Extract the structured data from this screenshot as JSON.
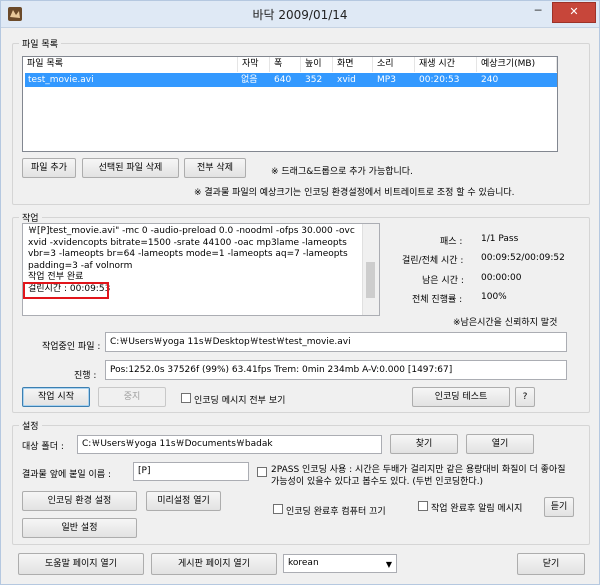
{
  "window": {
    "title": "바닥 2009/01/14",
    "minimize": "─",
    "close": "✕"
  },
  "file_list": {
    "group_label": "파일 목록",
    "columns": [
      "파일 목록",
      "자막",
      "폭",
      "높이",
      "화면",
      "소리",
      "재생 시간",
      "예상크기(MB)"
    ],
    "rows": [
      {
        "name": "test_movie.avi",
        "subtitle": "없음",
        "width": "640",
        "height": "352",
        "video": "xvid",
        "audio": "MP3",
        "duration": "00:20:53",
        "size": "240"
      }
    ],
    "add_button": "파일 추가",
    "delete_selected_button": "선택된 파일 삭제",
    "delete_all_button": "전부 삭제",
    "drag_hint": "※ 드래그&드롭으로 추가 가능합니다.",
    "size_hint": "※ 결과물 파일의 예상크기는 인코딩 환경설정에서 비트레이트로 조정 할 수 있습니다."
  },
  "job": {
    "group_label": "작업",
    "log_text": "￦[P]test_movie.avi\" -mc 0 -audio-preload 0.0 -noodml -ofps 30.000 -ovc xvid -xvidencopts bitrate=1500 -srate 44100 -oac mp3lame -lameopts vbr=3 -lameopts br=64 -lameopts mode=1 -lameopts aq=7 -lameopts padding=3 -af volnorm\n작업 전부 완료\n걸린시간 : 00:09:53",
    "pass_label": "패스 :",
    "pass_value": "1/1 Pass",
    "elapsed_label": "걸린/전체 시간 :",
    "elapsed_value": "00:09:52/00:09:52",
    "remaining_label": "남은 시간 :",
    "remaining_value": "00:00:00",
    "progress_label": "전체 진행률 :",
    "progress_value": "100%",
    "remaining_note": "※남은시간을 신뢰하지 말것",
    "current_file_label": "작업중인 파일 :",
    "current_file_value": "C:￦Users￦yoga 11s￦Desktop￦test￦test_movie.avi",
    "status_label": "진행 :",
    "status_value": "Pos:1252.0s  37526f (99%) 63.41fps Trem:   0min 234mb  A-V:0.000 [1497:67]",
    "start_button": "작업 시작",
    "stop_button": "중지",
    "show_all_messages": "인코딩 메시지 전부 보기",
    "encode_test_button": "인코딩 테스트",
    "help_button": "?"
  },
  "settings": {
    "group_label": "설정",
    "target_folder_label": "대상 폴더 :",
    "target_folder_value": "C:￦Users￦yoga 11s￦Documents￦badak",
    "find_button": "찾기",
    "open_button": "열기",
    "prefix_label": "결과물 앞에 붙일 이름 :",
    "prefix_value": "[P]",
    "two_pass_text": "2PASS 인코딩 사용 : 시간은 두배가 걸리지만 같은 용량대비 화질이 더 좋아질 가능성이 있을수 있다고 봅수도 있다. (두번 인코딩한다.)",
    "encode_settings_button": "인코딩 환경 설정",
    "preset_button": "미리설정 열기",
    "shutdown_text": "인코딩 완료후 컴퓨터 끄기",
    "alarm_text": "작업 완료후 알림 메시지",
    "listen_button": "듣기",
    "general_settings_button": "일반 설정"
  },
  "footer": {
    "help_page_button": "도움말 페이지 열기",
    "board_page_button": "게시판 페이지 열기",
    "language_value": "korean",
    "close_button": "닫기"
  },
  "colors": {
    "selection": "#3399ff",
    "highlight_box": "#e1151b",
    "title_bg": "#dfe9f5",
    "close_btn": "#c7463a"
  }
}
